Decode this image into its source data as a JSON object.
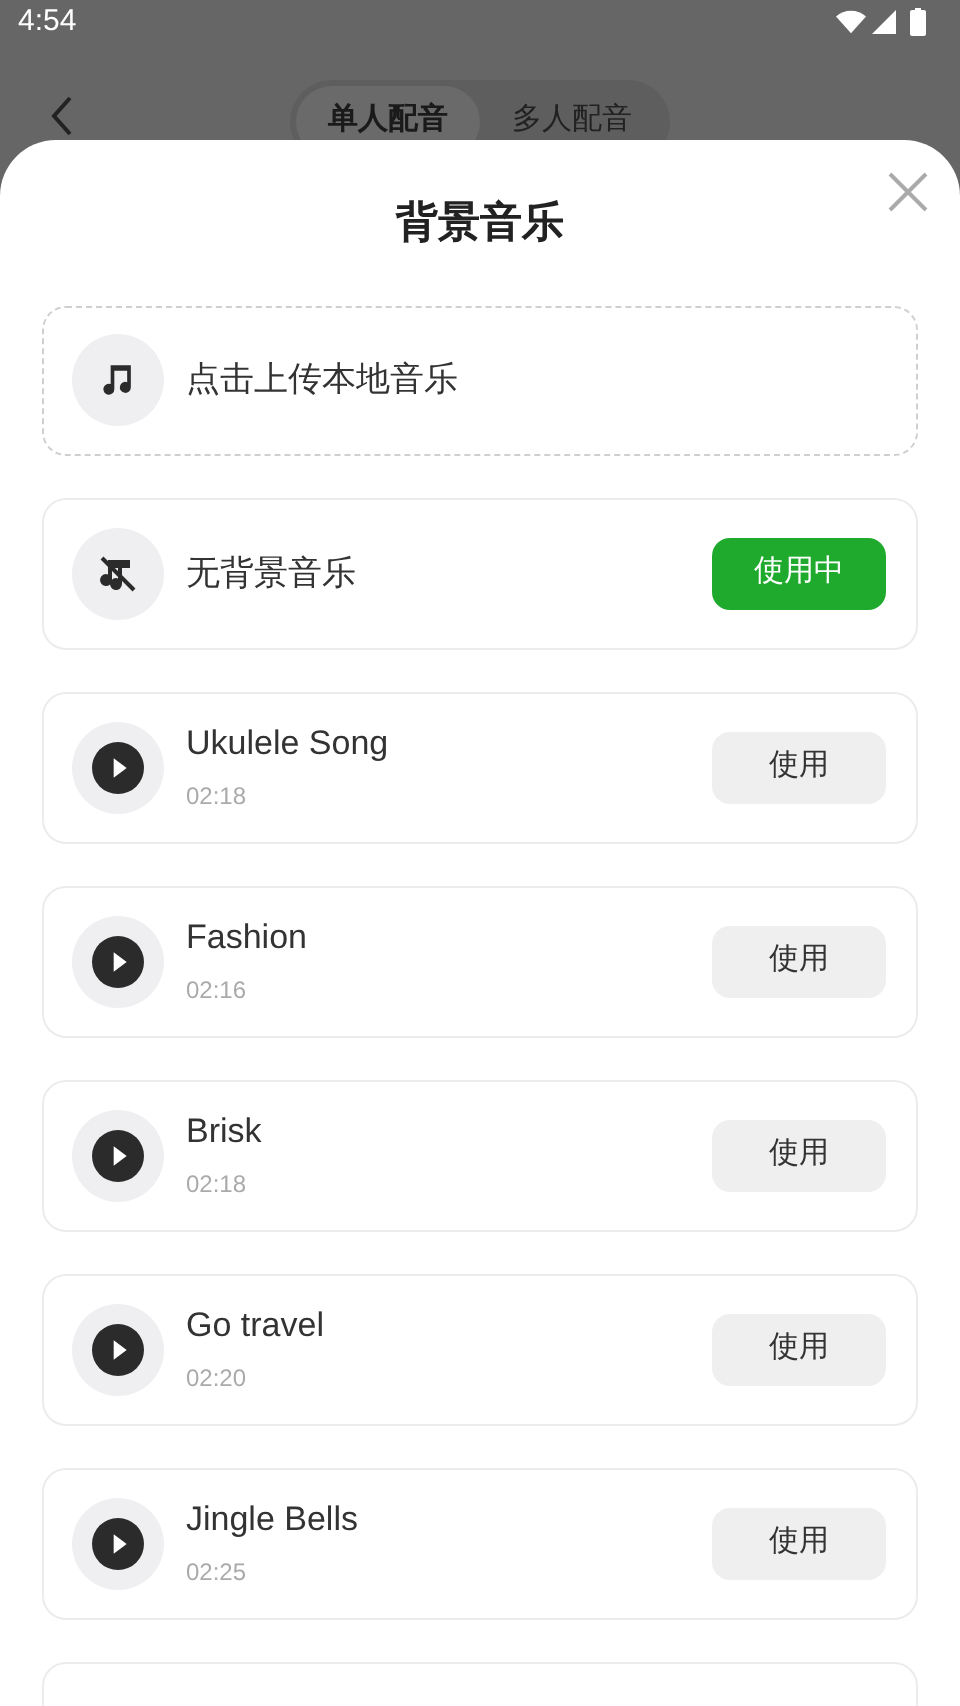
{
  "status_bar": {
    "time": "4:54"
  },
  "header": {
    "tabs": [
      {
        "label": "单人配音",
        "selected": true
      },
      {
        "label": "多人配音",
        "selected": false
      }
    ]
  },
  "sheet": {
    "title": "背景音乐",
    "upload": {
      "label": "点击上传本地音乐"
    },
    "items": [
      {
        "kind": "none",
        "title": "无背景音乐",
        "button": "使用中",
        "selected": true
      },
      {
        "kind": "song",
        "title": "Ukulele Song",
        "duration": "02:18",
        "button": "使用",
        "selected": false
      },
      {
        "kind": "song",
        "title": "Fashion",
        "duration": "02:16",
        "button": "使用",
        "selected": false
      },
      {
        "kind": "song",
        "title": "Brisk",
        "duration": "02:18",
        "button": "使用",
        "selected": false
      },
      {
        "kind": "song",
        "title": "Go travel",
        "duration": "02:20",
        "button": "使用",
        "selected": false
      },
      {
        "kind": "song",
        "title": "Jingle Bells",
        "duration": "02:25",
        "button": "使用",
        "selected": false
      }
    ]
  }
}
